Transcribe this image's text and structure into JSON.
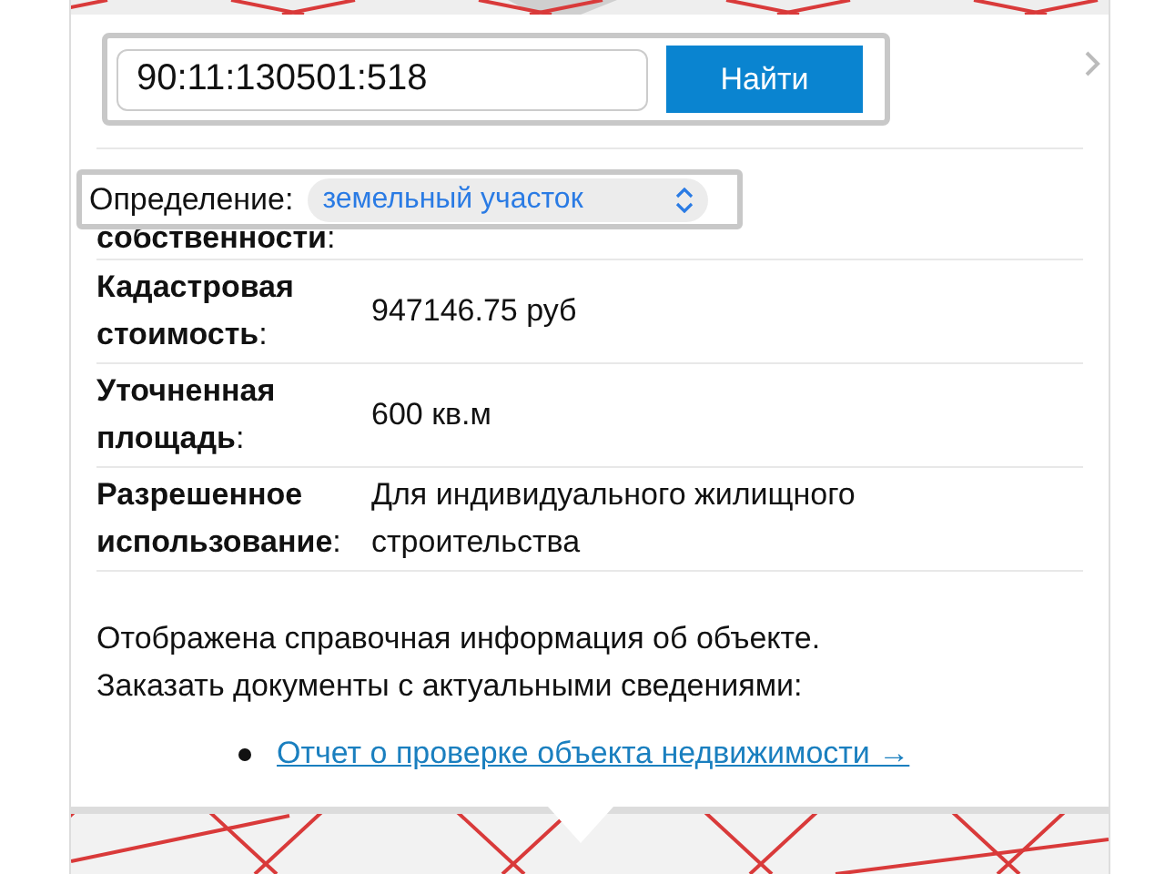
{
  "search": {
    "value": "90:11:130501:518",
    "button": "Найти"
  },
  "filter": {
    "label": "Определение:",
    "value": "земельный участок"
  },
  "properties": [
    {
      "label": "**собственности**:"
    },
    {
      "label": "**Кадастровая стоимость**:",
      "value": "947146.75 руб"
    },
    {
      "label": "**Уточненная площадь**:",
      "value": "600 кв.м"
    },
    {
      "label": "**Разрешенное использование**:",
      "value": "Для индивидуального жилищного строительства"
    }
  ],
  "note": "Отображена справочная информация об объекте. Заказать документы с актуальными сведениями:",
  "links": [
    "Отчет о проверке объекта недвижимости →"
  ]
}
